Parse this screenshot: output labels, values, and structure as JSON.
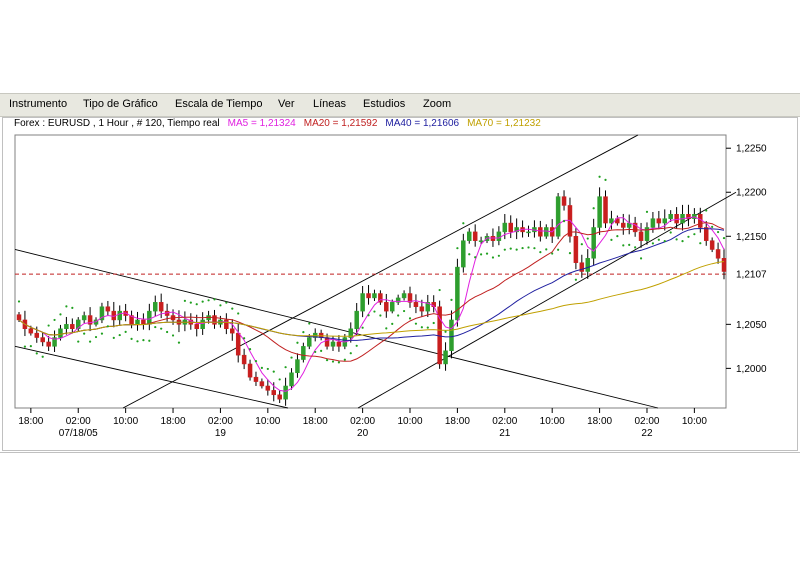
{
  "menu": {
    "items": [
      "Instrumento",
      "Tipo de Gráfico",
      "Escala de Tiempo",
      "Ver",
      "Líneas",
      "Estudios",
      "Zoom"
    ]
  },
  "info": {
    "instrument": "Forex : EURUSD , 1 Hour , # 120, Tiempo real",
    "ma5": "MA5 = 1,21324",
    "ma20": "MA20 = 1,21592",
    "ma40": "MA40 = 1,21606",
    "ma70": "MA70 = 1,21232"
  },
  "colors": {
    "up": "#2e9e2e",
    "down": "#c81e1e",
    "ma5": "#e020e0",
    "ma20": "#c02020",
    "ma40": "#2020a0",
    "ma70": "#c0a000",
    "sar": "#20a020",
    "reference": "#c02020"
  },
  "chart_data": {
    "type": "candlestick",
    "y_ticks": [
      "1,2250",
      "1,2200",
      "1,2150",
      "1,2050",
      "1,2000"
    ],
    "y_tick_values": [
      1.225,
      1.22,
      1.215,
      1.205,
      1.2
    ],
    "ylim": [
      1.1955,
      1.2265
    ],
    "current_price_label": "1,2107",
    "current_price": 1.2107,
    "x_ticks": [
      {
        "label": "18:00",
        "sub": "",
        "bar": 2
      },
      {
        "label": "02:00",
        "sub": "07/18/05",
        "bar": 10
      },
      {
        "label": "10:00",
        "sub": "",
        "bar": 18
      },
      {
        "label": "18:00",
        "sub": "",
        "bar": 26
      },
      {
        "label": "02:00",
        "sub": "19",
        "bar": 34
      },
      {
        "label": "10:00",
        "sub": "",
        "bar": 42
      },
      {
        "label": "18:00",
        "sub": "",
        "bar": 50
      },
      {
        "label": "02:00",
        "sub": "20",
        "bar": 58
      },
      {
        "label": "10:00",
        "sub": "",
        "bar": 66
      },
      {
        "label": "18:00",
        "sub": "",
        "bar": 74
      },
      {
        "label": "02:00",
        "sub": "21",
        "bar": 82
      },
      {
        "label": "10:00",
        "sub": "",
        "bar": 90
      },
      {
        "label": "18:00",
        "sub": "",
        "bar": 98
      },
      {
        "label": "02:00",
        "sub": "22",
        "bar": 106
      },
      {
        "label": "10:00",
        "sub": "",
        "bar": 114
      }
    ],
    "closes": [
      1.2055,
      1.2045,
      1.204,
      1.2035,
      1.203,
      1.2025,
      1.2035,
      1.2045,
      1.205,
      1.2045,
      1.2055,
      1.206,
      1.205,
      1.2055,
      1.207,
      1.2065,
      1.2055,
      1.2065,
      1.206,
      1.205,
      1.2055,
      1.205,
      1.2065,
      1.2075,
      1.2065,
      1.206,
      1.2055,
      1.205,
      1.2055,
      1.205,
      1.2045,
      1.2055,
      1.206,
      1.205,
      1.2055,
      1.2045,
      1.204,
      1.2015,
      1.2005,
      1.199,
      1.1985,
      1.198,
      1.1975,
      1.197,
      1.1965,
      1.198,
      1.1995,
      1.201,
      1.2025,
      1.2035,
      1.204,
      1.2035,
      1.2025,
      1.203,
      1.2025,
      1.2035,
      1.2045,
      1.2065,
      1.2085,
      1.208,
      1.2085,
      1.2075,
      1.2065,
      1.2075,
      1.208,
      1.2085,
      1.2075,
      1.207,
      1.2065,
      1.2075,
      1.207,
      1.2005,
      1.202,
      1.2055,
      1.2115,
      1.2145,
      1.2155,
      1.2145,
      1.2145,
      1.215,
      1.2145,
      1.2155,
      1.2165,
      1.2155,
      1.216,
      1.2155,
      1.2155,
      1.216,
      1.215,
      1.216,
      1.215,
      1.2195,
      1.2185,
      1.215,
      1.212,
      1.211,
      1.2125,
      1.216,
      1.2195,
      1.2165,
      1.217,
      1.2165,
      1.216,
      1.2165,
      1.2155,
      1.2145,
      1.216,
      1.217,
      1.2165,
      1.217,
      1.2175,
      1.2165,
      1.2175,
      1.217,
      1.2175,
      1.216,
      1.2145,
      1.2135,
      1.2125,
      1.211
    ],
    "series": [
      {
        "name": "MA5"
      },
      {
        "name": "MA20"
      },
      {
        "name": "MA40"
      },
      {
        "name": "MA70"
      }
    ],
    "grid": false
  }
}
